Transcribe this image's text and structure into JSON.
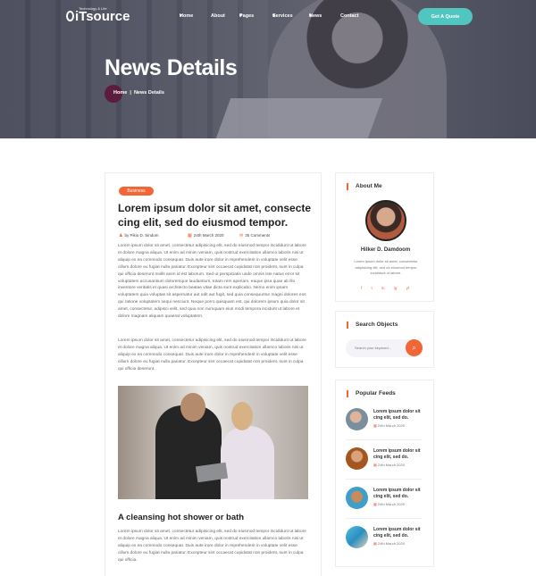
{
  "brand": {
    "logo": "iTsource",
    "tagline": "Technology & Life"
  },
  "nav": {
    "items": [
      "Home",
      "About",
      "Pages",
      "Services",
      "News",
      "Contact"
    ],
    "cta": "Get A Quote"
  },
  "hero": {
    "title": "News Details",
    "breadcrumb": {
      "home": "Home",
      "sep": "|",
      "current": "News Details"
    }
  },
  "post": {
    "badge": "Business",
    "title": "Lorem ipsum dolor sit amet, consectecing elit, sed do eiusmod tempor.",
    "title_line1": "Lorem ipsum dolor sit amet, consecte",
    "title_line2": "cing elit, sed do eiusmod tempor.",
    "author": "by Pikio D. Sindom",
    "date": "24th March 2020",
    "comments": "35 Comments",
    "para1": "Lorem ipsum dolor sit amet, consectetur adipisicing elit, sed do eiusmod tempor incididunt ut labore et dolore magna aliqua. Ut enim ad minim veniam, quis nostrud exercitation ullamco laboris nisi ut aliquip ex ea commodo consequat. Duis aute irure dolor in reprehenderit in voluptate velit esse cillum dolore eu fugiat nulla pariatur. Excepteur sint occaecat cupidatat non proident, sunt in culpa qui officia deserunt mollit anim id est laborum. Sed ut perspiciatis unde omnis iste natus error sit voluptatem accusantium doloremque laudantium, totam rem aperiam, eaque ipsa quae ab illo inventore veritatis et quasi architecto beatae vitae dicta sunt explicabo. Nemo enim ipsam voluptatem quia voluptas sit aspernatur aut odit aut fugit, sed quia consequuntur magni dolores eos qui ratione voluptatem sequi nesciunt. Neque porro quisquam est, qui dolorem ipsum quia dolor sit amet, consectetur, adipisci velit, sed quia non numquam eius modi tempora incidunt ut labore et dolore magnam aliquam quaerat voluptatem.",
    "para2": "Lorem ipsum dolor sit amet, consectetur adipisicing elit, sed do eiusmod tempor incididunt ut labore et dolore magna aliqua. Ut enim ad minim veniam, quis nostrud exercitation ullamco laboris nisi ut aliquip ex ea commodo consequat. Duis aute irure dolor in reprehenderit in voluptate velit esse cillum dolore eu fugiat nulla pariatur. Excepteur sint occaecat cupidatat non proident, sunt in culpa qui officia deserunt.",
    "subtitle": "A cleansing hot shower or bath",
    "para3": "Lorem ipsum dolor sit amet, consectetur adipisicing elit, sed do eiusmod tempor incididunt ut labore et dolore magna aliqua. Ut enim ad minim veniam, quis nostrud exercitation ullamco laboris nisi ut aliquip ex ea commodo consequat. Duis aute irure dolor in reprehenderit in voluptate velit esse cillum dolore eu fugiat nulla pariatur. Excepteur sint occaecat cupidatat non proident, sunt in culpa qui officia."
  },
  "about": {
    "title": "About Me",
    "name": "Hilker D. Damdoom",
    "desc": "Lorem ipsum dolor sit amet, consectetur adipisicing elit, sed do eiusmod tempor incididunt ut labore.",
    "socials": [
      "f",
      "t",
      "in",
      "ig",
      "yt"
    ]
  },
  "search": {
    "title": "Search Objects",
    "placeholder": "Search your keyword..."
  },
  "feeds": {
    "title": "Popular Feeds",
    "items": [
      {
        "title": "Lorem ipsum dolor sit cing elit, sed do.",
        "date": "24th March 2020"
      },
      {
        "title": "Lorem ipsum dolor sit cing elit, sed do.",
        "date": "24th March 2020"
      },
      {
        "title": "Lorem ipsum dolor sit cing elit, sed do.",
        "date": "24th March 2020"
      },
      {
        "title": "Lorem ipsum dolor sit cing elit, sed do.",
        "date": "24th March 2020"
      }
    ]
  },
  "colors": {
    "accent": "#f26535",
    "teal": "#51c5c0",
    "crumb": "#5b1c3e",
    "heading": "#222222"
  }
}
